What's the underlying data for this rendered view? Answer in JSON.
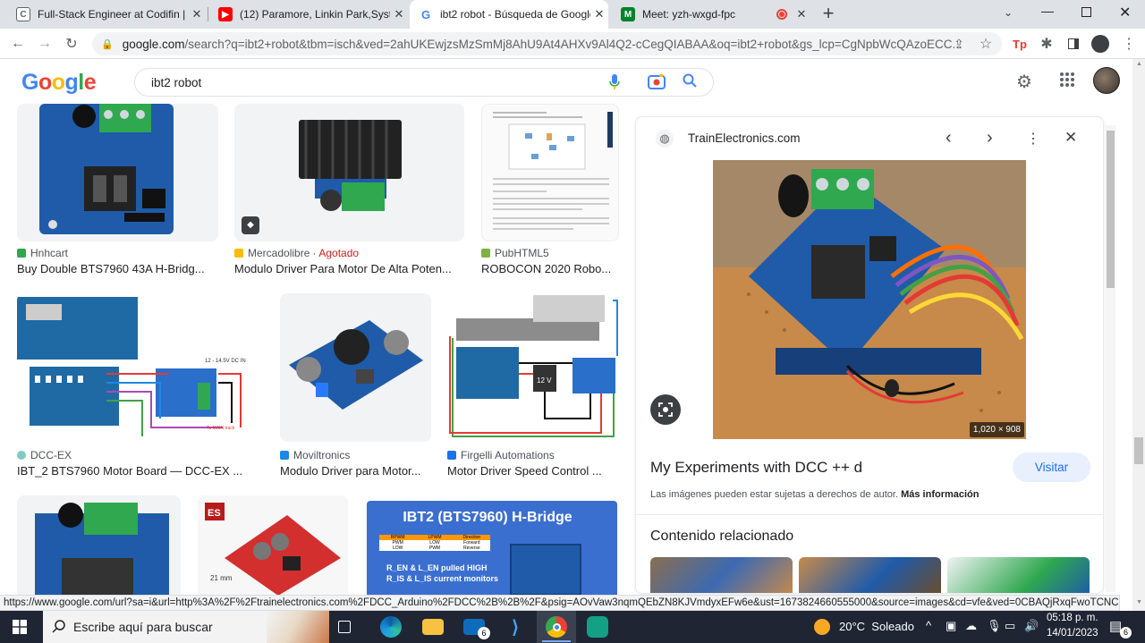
{
  "tabs": [
    {
      "label": "Full-Stack Engineer at Codifin | C",
      "favicon": "C",
      "color": "#5f6368"
    },
    {
      "label": "(12) Paramore, Linkin Park,System",
      "favicon": "▶",
      "color": "#ff0000"
    },
    {
      "label": "ibt2 robot - Búsqueda de Google",
      "favicon": "G",
      "color": "#4285f4"
    },
    {
      "label": "Meet: yzh-wxgd-fpc",
      "favicon": "M",
      "color": "#00832d"
    }
  ],
  "toolbar": {
    "url_host": "google.com",
    "url_path": "/search?q=ibt2+robot&tbm=isch&ved=2ahUKEwjzsMzSmMj8AhU9At4AHXv9Al4Q2-cCegQIABAA&oq=ibt2+robot&gs_lcp=CgNpbWcQAzoECC..."
  },
  "google": {
    "logo": "Google",
    "query": "ibt2 robot"
  },
  "results": [
    {
      "source": "Hnhcart",
      "title": "Buy Double BTS7960 43A H-Bridg...",
      "badge": ""
    },
    {
      "source": "Mercadolibre",
      "badge": "Agotado",
      "title": "Modulo Driver Para Motor De Alta Poten..."
    },
    {
      "source": "PubHTML5",
      "title": "ROBOCON 2020 Robo...",
      "badge": ""
    },
    {
      "source": "DCC-EX",
      "title": "IBT_2 BTS7960 Motor Board — DCC-EX ...",
      "badge": ""
    },
    {
      "source": "Moviltronics",
      "title": "Modulo Driver para Motor...",
      "badge": ""
    },
    {
      "source": "Firgelli Automations",
      "title": "Motor Driver Speed Control ...",
      "badge": ""
    }
  ],
  "thumb_texts": {
    "ibt2_banner": "IBT2 (BTS7960) H-Bridge",
    "ibt2_line1": "R_EN & L_EN pulled HIGH",
    "ibt2_line2": "R_IS & L_IS current monitors",
    "ibt2_table": [
      "RPWM",
      "LPWM",
      "Direction",
      "PWM",
      "LOW",
      "Forward",
      "LOW",
      "PWM",
      "Reverse"
    ],
    "firgelli_label": "12 V",
    "dcc_label": "12 - 14.5V DC IN",
    "dcc_label2": "To MAIN track",
    "es_logo": "ES",
    "es_dim": "21 mm"
  },
  "panel": {
    "site": "TrainElectronics.com",
    "dimensions": "1,020 × 908",
    "title": "My Experiments with DCC ++ d",
    "visit_label": "Visitar",
    "copyright_text": "Las imágenes pueden estar sujetas a derechos de autor.",
    "more_info": "Más información",
    "related_heading": "Contenido relacionado"
  },
  "status_url": "https://www.google.com/url?sa=i&url=http%3A%2F%2Ftrainelectronics.com%2FDCC_Arduino%2FDCC%2B%2B%2F&psig=AOvVaw3nqmQEbZN8KJVmdyxEFw6e&ust=1673824660555000&source=images&cd=vfe&ved=0CBAQjRxqFwoTCNC9m_WY...",
  "taskbar": {
    "search_placeholder": "Escribe aquí para buscar",
    "weather": "20°C  Soleado",
    "time": "05:18 p. m.",
    "date": "14/01/2023",
    "mail_badge": "6",
    "notif_badge": "6"
  },
  "colors": {
    "google_blue": "#4285f4",
    "google_red": "#ea4335",
    "google_yellow": "#fbbc05",
    "google_green": "#34a853",
    "agotado": "#c5221f",
    "visit_bg": "#e8f0fe",
    "visit_fg": "#1a73e8",
    "board_blue": "#1f5ba8",
    "terminal_green": "#2fa84f"
  }
}
